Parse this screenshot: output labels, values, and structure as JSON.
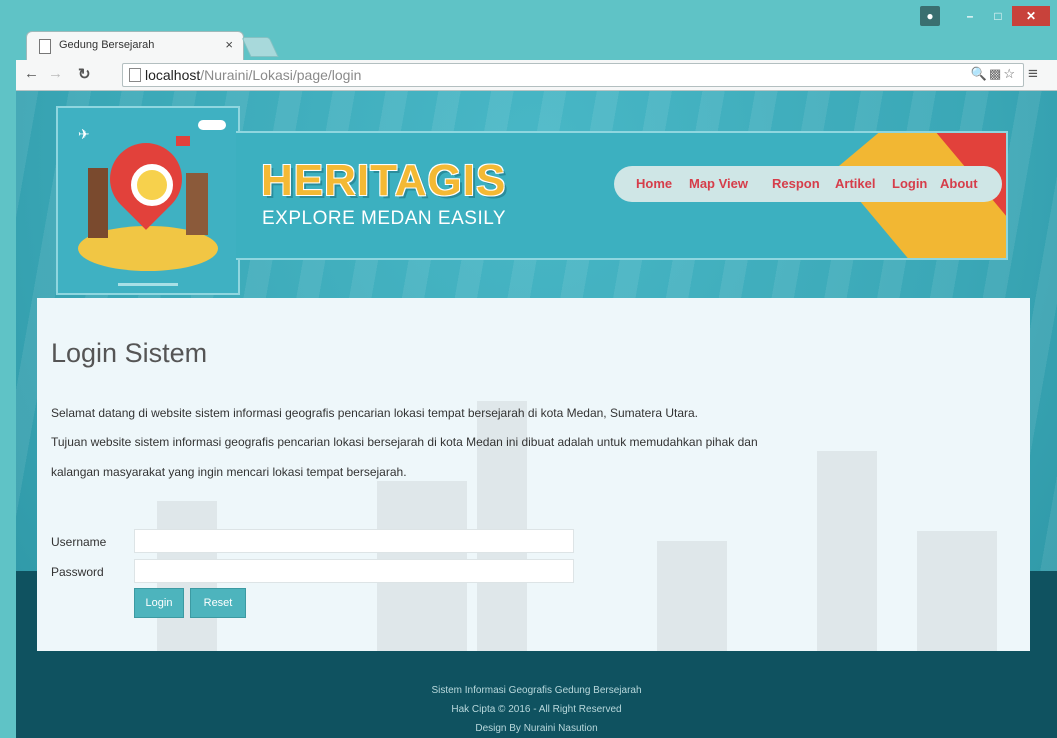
{
  "browser": {
    "tab_title": "Gedung Bersejarah",
    "tab_close": "×",
    "url_host": "localhost",
    "url_path": "/Nuraini/Lokasi/page/login"
  },
  "header": {
    "brand": "HERITAGIS",
    "tagline": "EXPLORE MEDAN EASILY",
    "menu": [
      "Home",
      "Map View",
      "Respon",
      "Artikel",
      "Login",
      "About"
    ]
  },
  "content": {
    "title": "Login Sistem",
    "paragraphs": [
      "Selamat datang di website sistem informasi geografis pencarian lokasi tempat bersejarah di kota Medan, Sumatera Utara.",
      "Tujuan website sistem informasi geografis pencarian lokasi bersejarah di kota Medan ini dibuat adalah untuk memudahkan pihak dan",
      "kalangan masyarakat yang ingin mencari lokasi tempat bersejarah."
    ]
  },
  "form": {
    "username_label": "Username",
    "username_value": "",
    "password_label": "Password",
    "password_value": "",
    "login_button": "Login",
    "reset_button": "Reset"
  },
  "footer": {
    "line1": "Sistem Informasi Geografis Gedung Bersejarah",
    "line2": "Hak Cipta © 2016 - All Right Reserved",
    "line3": "Design By Nuraini Nasution"
  },
  "colors": {
    "accent": "#4db4bd",
    "menu_text": "#d63d4a",
    "brand": "#f4b934",
    "footer_bg": "#0f5260"
  }
}
